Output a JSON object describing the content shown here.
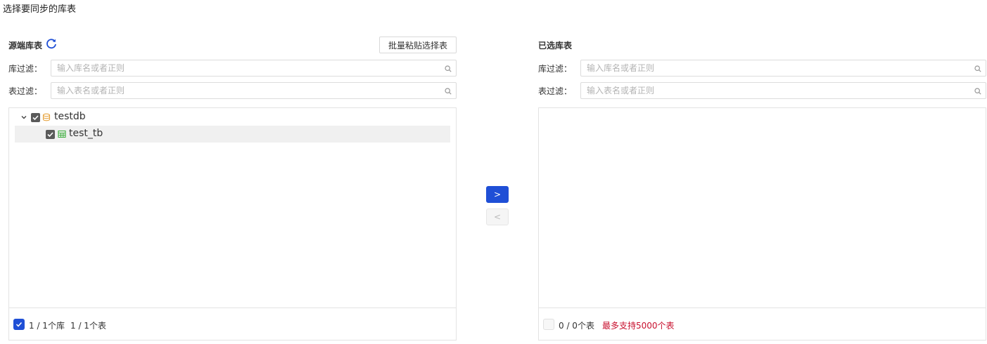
{
  "page": {
    "title": "选择要同步的库表"
  },
  "source": {
    "title": "源端库表",
    "paste_button": "批量粘贴选择表",
    "db_filter": {
      "label": "库过滤：",
      "placeholder": "输入库名或者正则"
    },
    "table_filter": {
      "label": "表过滤：",
      "placeholder": "输入表名或者正则"
    },
    "tree": {
      "db": {
        "label": "testdb",
        "checked": true,
        "expanded": true
      },
      "table": {
        "label": "test_tb",
        "checked": true
      }
    },
    "footer": {
      "db_count": "1 / 1个库",
      "table_count": "1 / 1个表"
    }
  },
  "transfer": {
    "to_right": ">",
    "to_left": "<"
  },
  "target": {
    "title": "已选库表",
    "db_filter": {
      "label": "库过滤：",
      "placeholder": "输入库名或者正则"
    },
    "table_filter": {
      "label": "表过滤：",
      "placeholder": "输入表名或者正则"
    },
    "footer": {
      "table_count": "0 / 0个表",
      "limit_notice": "最多支持5000个表"
    }
  },
  "colors": {
    "primary": "#1f4fd6",
    "warning": "#c8102e",
    "db_icon": "#e6a23c",
    "table_icon": "#3fae3f"
  }
}
